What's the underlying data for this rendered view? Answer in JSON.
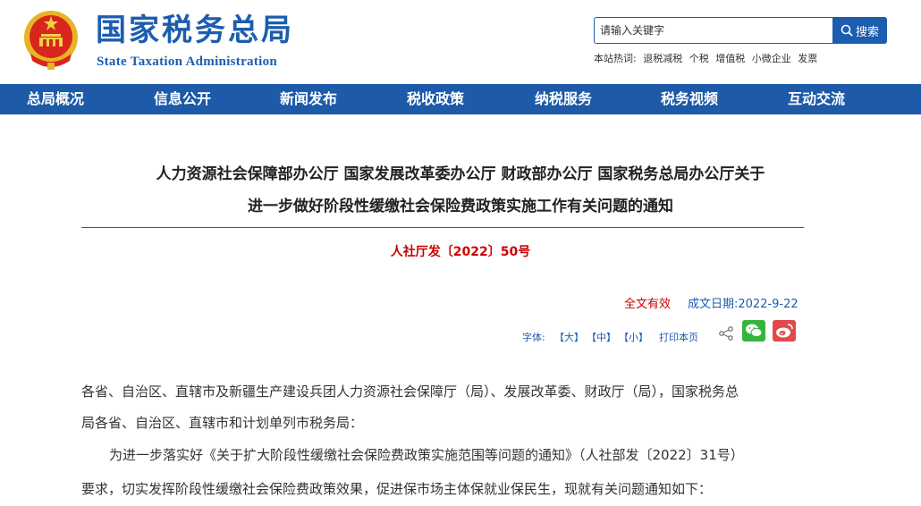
{
  "header": {
    "site_title": "国家税务总局",
    "site_subtitle": "State Taxation Administration",
    "search": {
      "placeholder": "请输入关键字",
      "button_label": "搜索"
    },
    "hot_words": {
      "label": "本站热词:",
      "items": [
        "退税减税",
        "个税",
        "增值税",
        "小微企业",
        "发票"
      ]
    }
  },
  "nav": {
    "items": [
      "总局概况",
      "信息公开",
      "新闻发布",
      "税收政策",
      "纳税服务",
      "税务视频",
      "互动交流"
    ]
  },
  "article": {
    "title_line1": "人力资源社会保障部办公厅 国家发展改革委办公厅 财政部办公厅 国家税务总局办公厅关于",
    "title_line2": "进一步做好阶段性缓缴社会保险费政策实施工作有关问题的通知",
    "doc_number": "人社厅发〔2022〕50号",
    "validity": "全文有效",
    "date": "成文日期:2022-9-22",
    "tools": {
      "font_label": "字体:",
      "large": "【大】",
      "medium": "【中】",
      "small": "【小】",
      "print": "打印本页"
    },
    "body": {
      "line1": "各省、自治区、直辖市及新疆生产建设兵团人力资源社会保障厅（局）、发展改革委、财政厅（局），国家税务总",
      "line2": "局各省、自治区、直辖市和计划单列市税务局：",
      "line3": "为进一步落实好《关于扩大阶段性缓缴社会保险费政策实施范围等问题的通知》（人社部发〔2022〕31号）",
      "line4": "要求，切实发挥阶段性缓缴社会保险费政策效果，促进保市场主体保就业保民生，现就有关问题通知如下："
    }
  },
  "colors": {
    "brand_blue": "#1c5db0",
    "nav_blue": "#1d5aa8",
    "doc_red": "#cc0000"
  }
}
